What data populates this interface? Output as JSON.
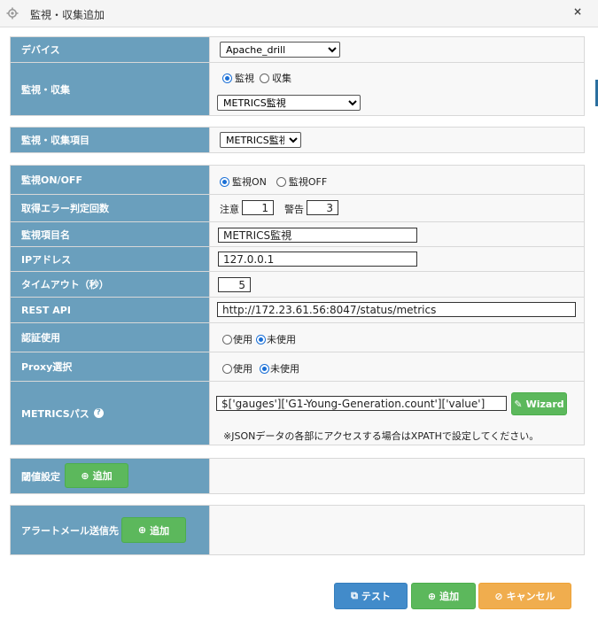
{
  "window": {
    "title": "監視・収集追加",
    "close_label": "×"
  },
  "device": {
    "label": "デバイス",
    "value": "Apache_drill"
  },
  "monitor_collect": {
    "label": "監視・収集",
    "options": [
      "監視",
      "収集"
    ],
    "selected": "監視",
    "type_value": "METRICS監視"
  },
  "monitor_item": {
    "label": "監視・収集項目",
    "value": "METRICS監視"
  },
  "fields": {
    "monitor_onoff": {
      "label": "監視ON/OFF",
      "options": [
        "監視ON",
        "監視OFF"
      ],
      "selected": "監視ON"
    },
    "error_count": {
      "label": "取得エラー判定回数",
      "caution_label": "注意",
      "caution_value": "1",
      "warning_label": "警告",
      "warning_value": "3"
    },
    "item_name": {
      "label": "監視項目名",
      "value": "METRICS監視"
    },
    "ip_address": {
      "label": "IPアドレス",
      "value": "127.0.0.1"
    },
    "timeout": {
      "label": "タイムアウト（秒）",
      "value": "5"
    },
    "rest_api": {
      "label": "REST API",
      "value": "http://172.23.61.56:8047/status/metrics"
    },
    "auth": {
      "label": "認証使用",
      "options": [
        "使用",
        "未使用"
      ],
      "selected": "未使用"
    },
    "proxy": {
      "label": "Proxy選択",
      "options": [
        "使用",
        "未使用"
      ],
      "selected": "未使用"
    },
    "metrics_path": {
      "label": "METRICSパス",
      "help_glyph": "?",
      "value": "$['gauges']['G1-Young-Generation.count']['value']",
      "wizard_label": "Wizard",
      "note": "※JSONデータの各部にアクセスする場合はXPATHで設定してください。"
    }
  },
  "threshold": {
    "label": "閾値設定",
    "add_label": "追加"
  },
  "alert_mail": {
    "label": "アラートメール送信先",
    "add_label": "追加"
  },
  "footer": {
    "test_label": "テスト",
    "add_label": "追加",
    "cancel_label": "キャンセル"
  },
  "colors": {
    "label_bg": "#6a9fbd",
    "green": "#5cb85c",
    "blue": "#428bca",
    "orange": "#f0ad4e",
    "radio": "#1a6fd6"
  }
}
